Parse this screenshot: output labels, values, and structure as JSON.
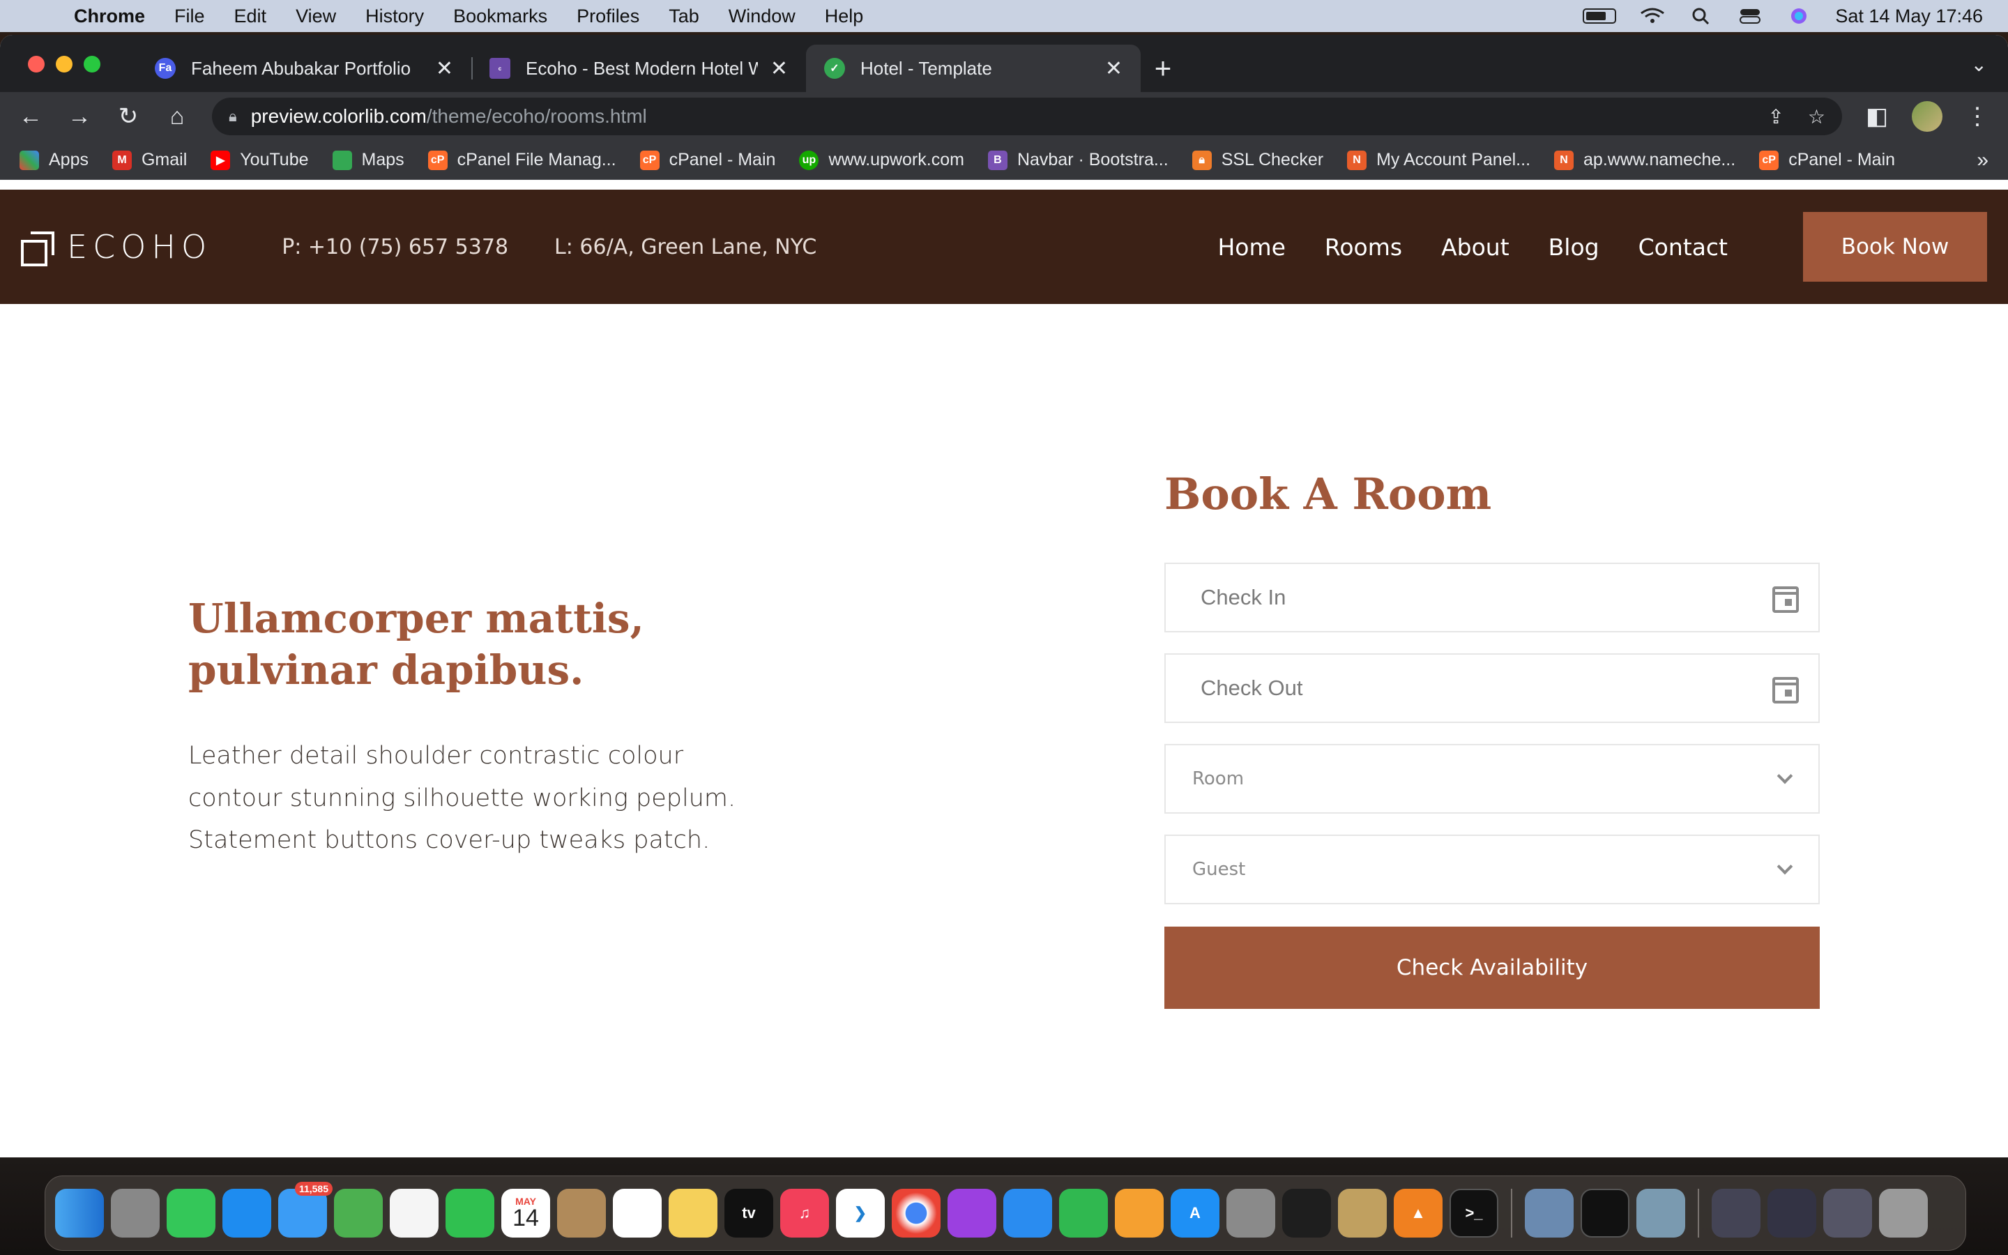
{
  "menubar": {
    "app": "Chrome",
    "items": [
      "File",
      "Edit",
      "View",
      "History",
      "Bookmarks",
      "Profiles",
      "Tab",
      "Window",
      "Help"
    ],
    "datetime": "Sat 14 May  17:46"
  },
  "browser": {
    "tabs": [
      {
        "title": "Faheem Abubakar Portfolio",
        "favicon": "Fa",
        "color": "#4a5de8"
      },
      {
        "title": "Ecoho - Best Modern Hotel We",
        "favicon": "colorlib",
        "color": "#6b4aa8"
      },
      {
        "title": "Hotel - Template",
        "favicon": "check",
        "color": "#34a853"
      }
    ],
    "url_host": "preview.colorlib.com",
    "url_path": "/theme/ecoho/rooms.html",
    "bookmarks": [
      {
        "label": "Apps",
        "color": "#e8453c"
      },
      {
        "label": "Gmail",
        "color": "#d93025"
      },
      {
        "label": "YouTube",
        "color": "#ff0000"
      },
      {
        "label": "Maps",
        "color": "#34a853"
      },
      {
        "label": "cPanel File Manag...",
        "color": "#ff6c2c"
      },
      {
        "label": "cPanel - Main",
        "color": "#ff6c2c"
      },
      {
        "label": "www.upwork.com",
        "color": "#14a800"
      },
      {
        "label": "Navbar · Bootstra...",
        "color": "#7952b3"
      },
      {
        "label": "SSL Checker",
        "color": "#f07c2a"
      },
      {
        "label": "My Account Panel...",
        "color": "#e85d2a"
      },
      {
        "label": "ap.www.nameche...",
        "color": "#e85d2a"
      },
      {
        "label": "cPanel - Main",
        "color": "#ff6c2c"
      }
    ]
  },
  "site": {
    "logo": "ECOHO",
    "phone": "P: +10 (75) 657 5378",
    "location": "L: 66/A, Green Lane, NYC",
    "nav": [
      "Home",
      "Rooms",
      "About",
      "Blog",
      "Contact"
    ],
    "book_now": "Book Now",
    "accent": "#a0573a",
    "header_bg": "#3b2116"
  },
  "hero": {
    "title_line1": "Ullamcorper mattis,",
    "title_line2": "pulvinar dapibus.",
    "text_line1": "Leather detail shoulder contrastic colour",
    "text_line2": "contour stunning silhouette working peplum.",
    "text_line3": "Statement buttons cover-up tweaks patch."
  },
  "booking": {
    "title": "Book A Room",
    "check_in": "Check In",
    "check_out": "Check Out",
    "room": "Room",
    "guest": "Guest",
    "submit": "Check Availability"
  },
  "dock": {
    "mail_badge": "11,585",
    "calendar_month": "MAY",
    "calendar_day": "14"
  }
}
